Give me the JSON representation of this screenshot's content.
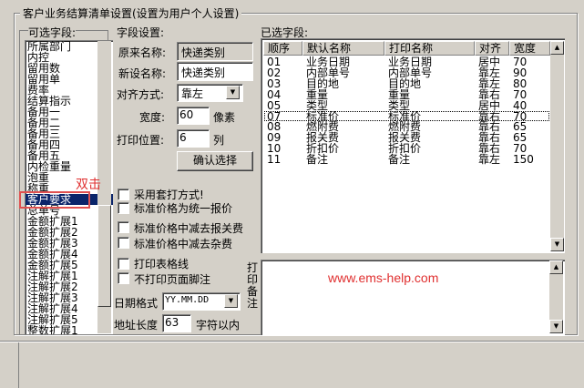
{
  "window": {
    "title": "客户业务结算清单设置(设置为用户个人设置)"
  },
  "available_fields": {
    "label": "可选字段:",
    "items": [
      "所属部门",
      "内控",
      "留用数",
      "留用单",
      "费率",
      "结算指示",
      "备用一",
      "备用二",
      "备用三",
      "备用四",
      "备用五",
      "内检重量",
      "泡重",
      "称重",
      "客户要求",
      "总单号",
      "金额扩展1",
      "金额扩展2",
      "金额扩展3",
      "金额扩展4",
      "金额扩展5",
      "注解扩展1",
      "注解扩展2",
      "注解扩展3",
      "注解扩展4",
      "注解扩展5",
      "整数扩展1"
    ],
    "selected_index": 14
  },
  "annotation": {
    "text": "双击"
  },
  "field_settings": {
    "label": "字段设置:",
    "original_name_label": "原来名称:",
    "original_name_value": "快递类别",
    "new_name_label": "新设名称:",
    "new_name_value": "快递类别",
    "align_label": "对齐方式:",
    "align_value": "靠左",
    "width_label": "宽度:",
    "width_value": "60",
    "width_unit": "像素",
    "print_pos_label": "打印位置:",
    "print_pos_value": "6",
    "print_pos_unit": "列",
    "confirm_button": "确认选择"
  },
  "options": {
    "use_template_print": "采用套打方式!",
    "standard_price_uniform": "标准价格为统一报价",
    "standard_price_minus_customs": "标准价格中减去报关费",
    "standard_price_minus_misc": "标准价格中减去杂费",
    "print_table_lines": "打印表格线",
    "no_page_footer": "不打印页面脚注",
    "date_format_label": "日期格式",
    "date_format_value": "YY.MM.DD",
    "address_length_label": "地址长度",
    "address_length_value": "63",
    "address_length_unit": "字符以内"
  },
  "selected_fields": {
    "label": "已选字段:",
    "columns": [
      "顺序",
      "默认名称",
      "打印名称",
      "对齐",
      "宽度"
    ],
    "rows": [
      [
        "01",
        "业务日期",
        "业务日期",
        "居中",
        "70"
      ],
      [
        "02",
        "内部单号",
        "内部单号",
        "靠左",
        "90"
      ],
      [
        "03",
        "目的地",
        "目的地",
        "靠左",
        "80"
      ],
      [
        "04",
        "重量",
        "重量",
        "靠右",
        "70"
      ],
      [
        "05",
        "类型",
        "类型",
        "居中",
        "40"
      ],
      [
        "07",
        "标准价",
        "标准价",
        "靠右",
        "70"
      ],
      [
        "08",
        "燃附费",
        "燃附费",
        "靠右",
        "65"
      ],
      [
        "09",
        "报关费",
        "报关费",
        "靠右",
        "65"
      ],
      [
        "10",
        "折扣价",
        "折扣价",
        "靠右",
        "70"
      ],
      [
        "11",
        "备注",
        "备注",
        "靠左",
        "150"
      ]
    ],
    "focused_row": 5
  },
  "print_note": {
    "label": "打印备注"
  },
  "watermark": "www.ems-help.com"
}
